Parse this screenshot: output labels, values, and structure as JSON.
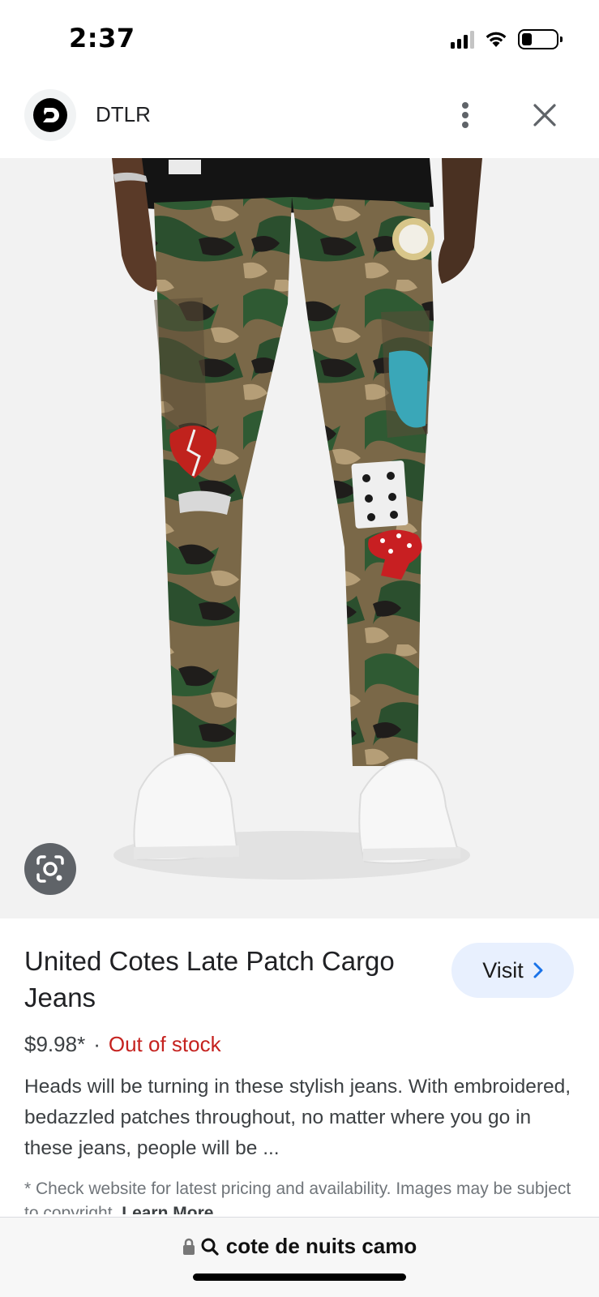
{
  "status_bar": {
    "time": "2:37",
    "battery_level": 0.3
  },
  "header": {
    "site_name": "DTLR",
    "logo_icon": "dtlr-logo",
    "more_icon": "more-vertical-icon",
    "close_icon": "close-icon"
  },
  "image": {
    "lens_icon": "google-lens-icon"
  },
  "product": {
    "title": "United Cotes Late Patch Cargo Jeans",
    "price": "$9.98*",
    "separator": "·",
    "stock_status": "Out of stock",
    "description": "Heads will be turning in these stylish jeans. With embroidered, bedazzled patches throughout, no matter where you go in these jeans, people will be ...",
    "disclaimer": "* Check website for latest pricing and availability. Images may be subject to copyright.",
    "learn_more": "Learn More",
    "visit_label": "Visit",
    "visit_icon": "chevron-right-icon"
  },
  "bottom_bar": {
    "url_text": "cote de nuits camo",
    "lock_icon": "lock-icon",
    "search_icon": "search-icon"
  },
  "colors": {
    "visit_bg": "#e8f0fe",
    "stock_red": "#c5221f",
    "link_blue": "#1a73e8"
  }
}
